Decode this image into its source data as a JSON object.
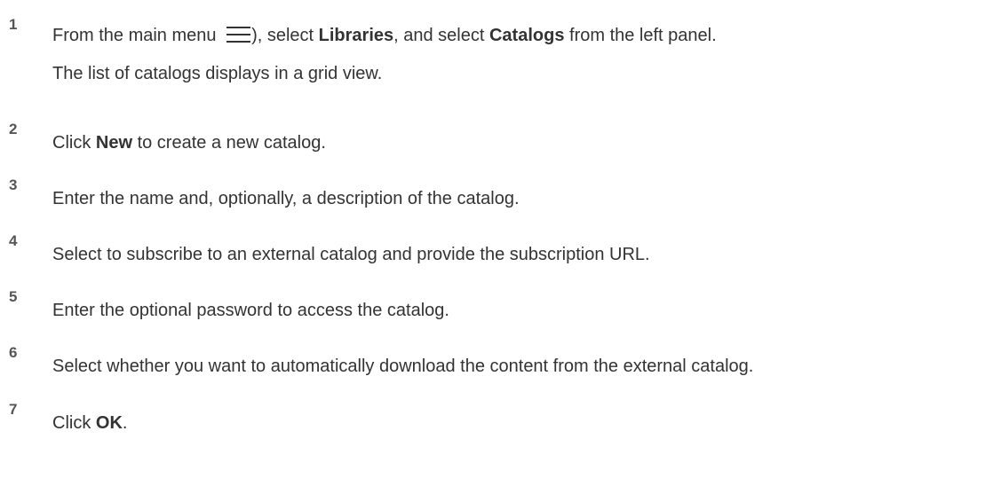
{
  "steps": [
    {
      "number": "1",
      "line1": {
        "t1": "From the main menu ",
        "t2": "), select ",
        "b1": "Libraries",
        "t3": ", and select ",
        "b2": "Catalogs",
        "t4": " from the left panel."
      },
      "line2": "The list of catalogs displays in a grid view.",
      "icon": "menu-icon"
    },
    {
      "number": "2",
      "t1": "Click ",
      "b1": "New",
      "t2": " to create a new catalog."
    },
    {
      "number": "3",
      "text": "Enter the name and, optionally, a description of the catalog."
    },
    {
      "number": "4",
      "text": "Select to subscribe to an external catalog and provide the subscription URL."
    },
    {
      "number": "5",
      "text": "Enter the optional password to access the catalog."
    },
    {
      "number": "6",
      "text": "Select whether you want to automatically download the content from the external catalog."
    },
    {
      "number": "7",
      "t1": "Click ",
      "b1": "OK",
      "t2": "."
    }
  ]
}
